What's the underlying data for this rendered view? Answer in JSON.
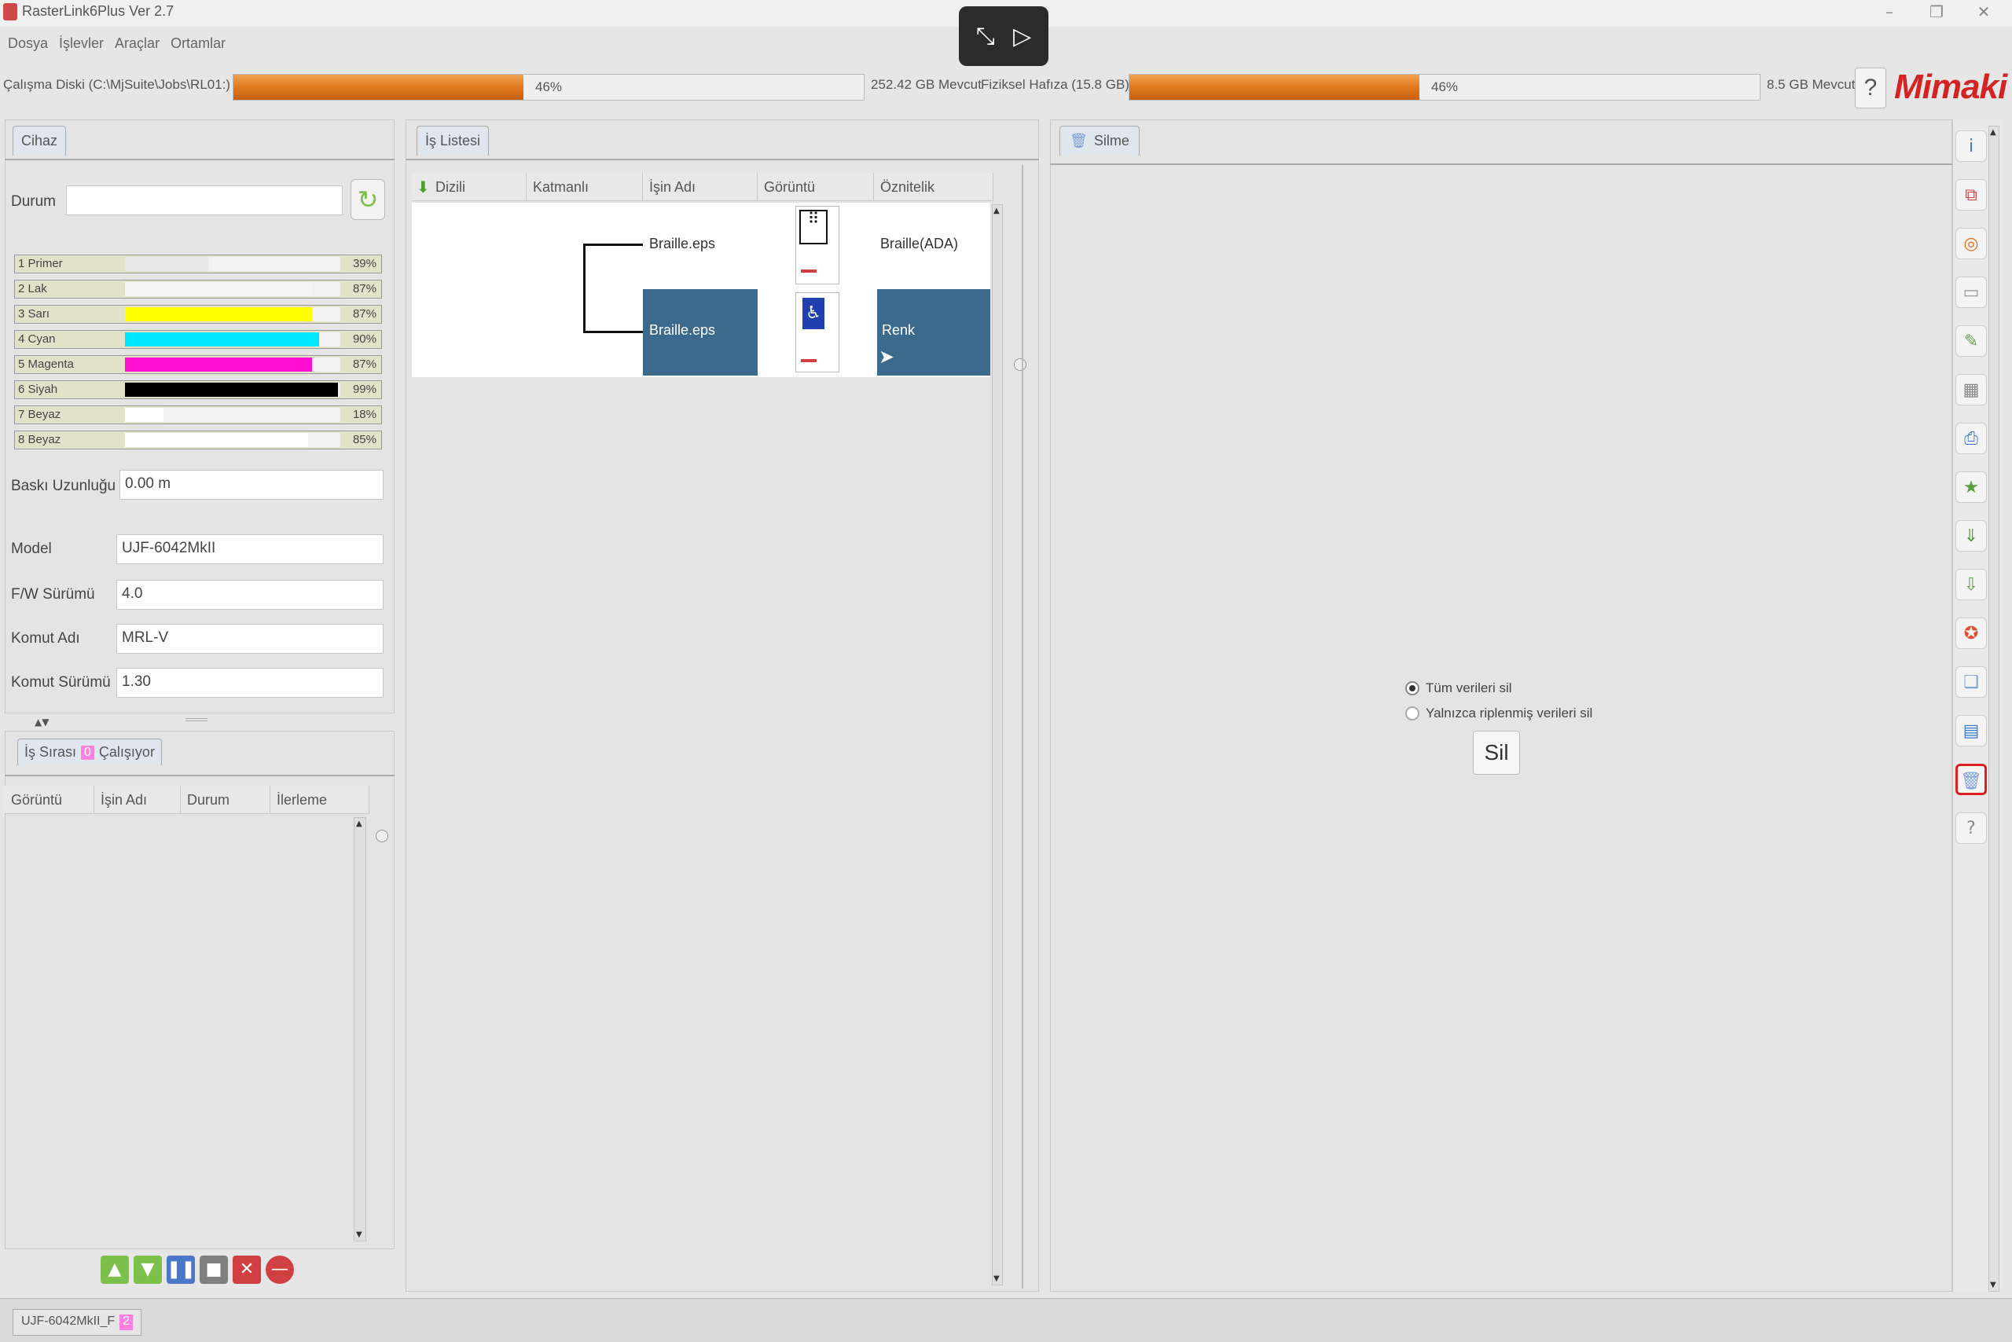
{
  "window": {
    "title": "RasterLink6Plus Ver 2.7",
    "controls": {
      "minimize": "–",
      "restore": "❐",
      "close": "✕"
    }
  },
  "menu": [
    "Dosya",
    "İşlevler",
    "Araçlar",
    "Ortamlar"
  ],
  "overlay": {
    "exit_icon": "⤡",
    "play_icon": "▷"
  },
  "disk": {
    "work_disk_label": "Çalışma Diski (C:\\MjSuite\\Jobs\\RL01:)",
    "work_disk_percent": 46,
    "work_disk_percent_label": "46%",
    "work_disk_free": "252.42 GB Mevcut",
    "memory_label": "Fiziksel Hafıza (15.8 GB)",
    "memory_percent": 46,
    "memory_percent_label": "46%",
    "memory_free": "8.5 GB Mevcut",
    "help": "?",
    "logo": "Mimaki",
    "bar_color": "#e07a20"
  },
  "device_panel": {
    "tab": "Cihaz",
    "status_label": "Durum",
    "status_value": "",
    "inks": [
      {
        "label": "1 Primer",
        "percent": 39,
        "percent_label": "39%",
        "color": "#e8e8e8"
      },
      {
        "label": "2 Lak",
        "percent": 87,
        "percent_label": "87%",
        "color": "#f5f5f5"
      },
      {
        "label": "3 Sarı",
        "percent": 87,
        "percent_label": "87%",
        "color": "#ffff00"
      },
      {
        "label": "4 Cyan",
        "percent": 90,
        "percent_label": "90%",
        "color": "#00e8ff"
      },
      {
        "label": "5 Magenta",
        "percent": 87,
        "percent_label": "87%",
        "color": "#ff10d0"
      },
      {
        "label": "6 Siyah",
        "percent": 99,
        "percent_label": "99%",
        "color": "#000000"
      },
      {
        "label": "7 Beyaz",
        "percent": 18,
        "percent_label": "18%",
        "color": "#ffffff"
      },
      {
        "label": "8 Beyaz",
        "percent": 85,
        "percent_label": "85%",
        "color": "#ffffff"
      }
    ],
    "print_length_label": "Baskı Uzunluğu",
    "print_length_value": "0.00 m",
    "model_label": "Model",
    "model_value": "UJF-6042MkII",
    "fw_label": "F/W Sürümü",
    "fw_value": "4.0",
    "command_name_label": "Komut Adı",
    "command_name_value": "MRL-V",
    "command_version_label": "Komut Sürümü",
    "command_version_value": "1.30"
  },
  "queue_panel": {
    "tab": "İş Sırası",
    "badge": "0",
    "running": "Çalışıyor",
    "columns": [
      "Görüntü",
      "İşin Adı",
      "Durum",
      "İlerleme"
    ],
    "buttons": [
      {
        "name": "move-up",
        "glyph": "▲",
        "color": "#7cbf4a"
      },
      {
        "name": "move-down",
        "glyph": "▼",
        "color": "#7cbf4a"
      },
      {
        "name": "pause",
        "glyph": "❚❚",
        "color": "#4a78c8"
      },
      {
        "name": "stop",
        "glyph": "■",
        "color": "#808080"
      },
      {
        "name": "cancel",
        "glyph": "✕",
        "color": "#d04040"
      },
      {
        "name": "delete",
        "glyph": "—",
        "color": "#d04040"
      }
    ]
  },
  "job_list": {
    "tab": "İş Listesi",
    "columns": [
      "Dizili",
      "Katmanlı",
      "İşin Adı",
      "Görüntü",
      "Öznitelik"
    ],
    "rows": [
      {
        "name": "Braille.eps",
        "attribute": "Braille(ADA)",
        "selected": false
      },
      {
        "name": "Braille.eps",
        "attribute": "Renk",
        "selected": true
      }
    ],
    "select_color": "#3c6a8c"
  },
  "delete_panel": {
    "tab": "Silme",
    "option_all": "Tüm verileri sil",
    "option_ripped": "Yalnızca riplenmiş verileri sil",
    "selected_option": "all",
    "button": "Sil"
  },
  "status_bar": {
    "device_tab": "UJF-6042MkII_F",
    "badge": "2"
  },
  "sidebar_icons": [
    {
      "name": "info-icon",
      "glyph": "i",
      "color": "#3a78d0",
      "active": false
    },
    {
      "name": "layout-icon",
      "glyph": "⧉",
      "color": "#d04848",
      "active": false
    },
    {
      "name": "color-wheel-icon",
      "glyph": "◎",
      "color": "#e07020",
      "active": false
    },
    {
      "name": "blank-icon",
      "glyph": "▭",
      "color": "#999999",
      "active": false
    },
    {
      "name": "edit-icon",
      "glyph": "✎",
      "color": "#6aa050",
      "active": false
    },
    {
      "name": "grid-icon",
      "glyph": "▦",
      "color": "#888888",
      "active": false
    },
    {
      "name": "print-icon",
      "glyph": "⎙",
      "color": "#3a78d0",
      "active": false
    },
    {
      "name": "star-icon",
      "glyph": "★",
      "color": "#5aa040",
      "active": false
    },
    {
      "name": "down-icon",
      "glyph": "⇓",
      "color": "#5aa040",
      "active": false
    },
    {
      "name": "down2-icon",
      "glyph": "⇩",
      "color": "#5aa040",
      "active": false
    },
    {
      "name": "palette-icon",
      "glyph": "✪",
      "color": "#e05030",
      "active": false
    },
    {
      "name": "copy-icon",
      "glyph": "❏",
      "color": "#7aa0d8",
      "active": false
    },
    {
      "name": "split-icon",
      "glyph": "▤",
      "color": "#3a78d0",
      "active": false
    },
    {
      "name": "trash-icon",
      "glyph": "🗑",
      "color": "#7aa0d8",
      "active": true
    },
    {
      "name": "question-icon",
      "glyph": "?",
      "color": "#888888",
      "active": false
    }
  ]
}
